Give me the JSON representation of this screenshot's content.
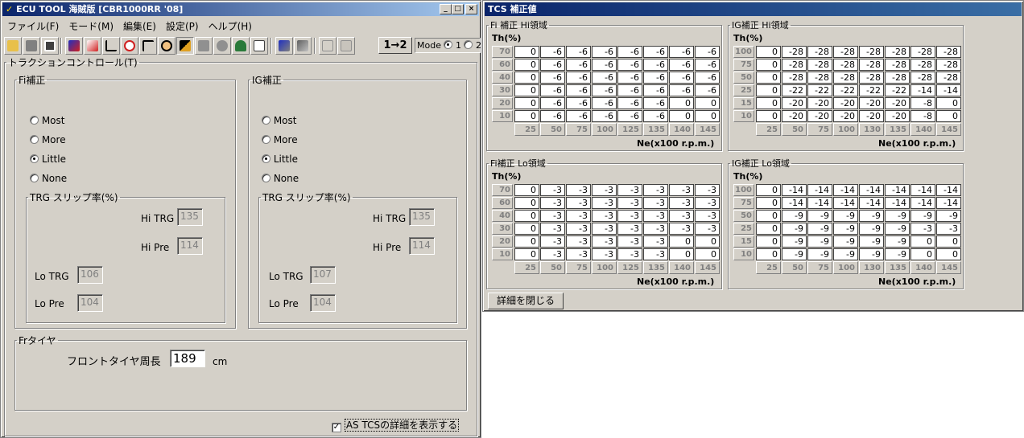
{
  "left_window": {
    "title": "ECU TOOL 海賊版 [CBR1000RR '08]",
    "title_buttons": [
      "_",
      "□",
      "×"
    ],
    "menu": [
      "ファイル(F)",
      "モード(M)",
      "編集(E)",
      "設定(P)",
      "ヘルプ(H)"
    ],
    "arrow_button": "1→2",
    "mode": {
      "label": "Mode",
      "opt1": "1",
      "opt2": "2",
      "selected": "1"
    },
    "section_title": "トラクションコントロール(T)",
    "fi": {
      "title": "Fi補正",
      "options": [
        "Most",
        "More",
        "Little",
        "None"
      ],
      "selected": "Little",
      "trg_title": "TRG スリップ率(%)",
      "hi_trg_label": "Hi TRG",
      "hi_trg": "135",
      "hi_pre_label": "Hi Pre",
      "hi_pre": "114",
      "lo_trg_label": "Lo TRG",
      "lo_trg": "106",
      "lo_pre_label": "Lo Pre",
      "lo_pre": "104"
    },
    "ig": {
      "title": "IG補正",
      "options": [
        "Most",
        "More",
        "Little",
        "None"
      ],
      "selected": "Little",
      "trg_title": "TRG スリップ率(%)",
      "hi_trg_label": "Hi TRG",
      "hi_trg": "135",
      "hi_pre_label": "Hi Pre",
      "hi_pre": "114",
      "lo_trg_label": "Lo TRG",
      "lo_trg": "107",
      "lo_pre_label": "Lo Pre",
      "lo_pre": "104"
    },
    "tire": {
      "title": "Frタイヤ",
      "label": "フロントタイヤ周長",
      "value": "189",
      "unit": "cm"
    },
    "checkbox_label": "AS TCSの詳細を表示する",
    "checkbox_checked": true
  },
  "right_window": {
    "title": "TCS 補正値",
    "close_button": "詳細を閉じる",
    "grids": [
      {
        "title": "Fi 補正 Hi領域",
        "th_label": "Th(%)",
        "ne_label": "Ne(x100 r.p.m.)",
        "rows": [
          "70",
          "60",
          "40",
          "30",
          "20",
          "10"
        ],
        "cols": [
          "25",
          "50",
          "75",
          "100",
          "125",
          "135",
          "140",
          "145"
        ],
        "values": [
          [
            "0",
            "-6",
            "-6",
            "-6",
            "-6",
            "-6",
            "-6",
            "-6"
          ],
          [
            "0",
            "-6",
            "-6",
            "-6",
            "-6",
            "-6",
            "-6",
            "-6"
          ],
          [
            "0",
            "-6",
            "-6",
            "-6",
            "-6",
            "-6",
            "-6",
            "-6"
          ],
          [
            "0",
            "-6",
            "-6",
            "-6",
            "-6",
            "-6",
            "-6",
            "-6"
          ],
          [
            "0",
            "-6",
            "-6",
            "-6",
            "-6",
            "-6",
            "0",
            "0"
          ],
          [
            "0",
            "-6",
            "-6",
            "-6",
            "-6",
            "-6",
            "0",
            "0"
          ]
        ]
      },
      {
        "title": "IG補正 Hi領域",
        "th_label": "Th(%)",
        "ne_label": "Ne(x100 r.p.m.)",
        "rows": [
          "100",
          "75",
          "50",
          "25",
          "15",
          "10"
        ],
        "cols": [
          "25",
          "50",
          "75",
          "100",
          "130",
          "135",
          "140",
          "145"
        ],
        "values": [
          [
            "0",
            "-28",
            "-28",
            "-28",
            "-28",
            "-28",
            "-28",
            "-28"
          ],
          [
            "0",
            "-28",
            "-28",
            "-28",
            "-28",
            "-28",
            "-28",
            "-28"
          ],
          [
            "0",
            "-28",
            "-28",
            "-28",
            "-28",
            "-28",
            "-28",
            "-28"
          ],
          [
            "0",
            "-22",
            "-22",
            "-22",
            "-22",
            "-22",
            "-14",
            "-14"
          ],
          [
            "0",
            "-20",
            "-20",
            "-20",
            "-20",
            "-20",
            "-8",
            "0"
          ],
          [
            "0",
            "-20",
            "-20",
            "-20",
            "-20",
            "-20",
            "-8",
            "0"
          ]
        ]
      },
      {
        "title": "Fi補正 Lo領域",
        "th_label": "Th(%)",
        "ne_label": "Ne(x100 r.p.m.)",
        "rows": [
          "70",
          "60",
          "40",
          "30",
          "20",
          "10"
        ],
        "cols": [
          "25",
          "50",
          "75",
          "100",
          "125",
          "135",
          "140",
          "145"
        ],
        "values": [
          [
            "0",
            "-3",
            "-3",
            "-3",
            "-3",
            "-3",
            "-3",
            "-3"
          ],
          [
            "0",
            "-3",
            "-3",
            "-3",
            "-3",
            "-3",
            "-3",
            "-3"
          ],
          [
            "0",
            "-3",
            "-3",
            "-3",
            "-3",
            "-3",
            "-3",
            "-3"
          ],
          [
            "0",
            "-3",
            "-3",
            "-3",
            "-3",
            "-3",
            "-3",
            "-3"
          ],
          [
            "0",
            "-3",
            "-3",
            "-3",
            "-3",
            "-3",
            "0",
            "0"
          ],
          [
            "0",
            "-3",
            "-3",
            "-3",
            "-3",
            "-3",
            "0",
            "0"
          ]
        ]
      },
      {
        "title": "IG補正 Lo領域",
        "th_label": "Th(%)",
        "ne_label": "Ne(x100 r.p.m.)",
        "rows": [
          "100",
          "75",
          "50",
          "25",
          "15",
          "10"
        ],
        "cols": [
          "25",
          "50",
          "75",
          "100",
          "130",
          "135",
          "140",
          "145"
        ],
        "values": [
          [
            "0",
            "-14",
            "-14",
            "-14",
            "-14",
            "-14",
            "-14",
            "-14"
          ],
          [
            "0",
            "-14",
            "-14",
            "-14",
            "-14",
            "-14",
            "-14",
            "-14"
          ],
          [
            "0",
            "-9",
            "-9",
            "-9",
            "-9",
            "-9",
            "-9",
            "-9"
          ],
          [
            "0",
            "-9",
            "-9",
            "-9",
            "-9",
            "-9",
            "-3",
            "-3"
          ],
          [
            "0",
            "-9",
            "-9",
            "-9",
            "-9",
            "-9",
            "0",
            "0"
          ],
          [
            "0",
            "-9",
            "-9",
            "-9",
            "-9",
            "-9",
            "0",
            "0"
          ]
        ]
      }
    ]
  }
}
